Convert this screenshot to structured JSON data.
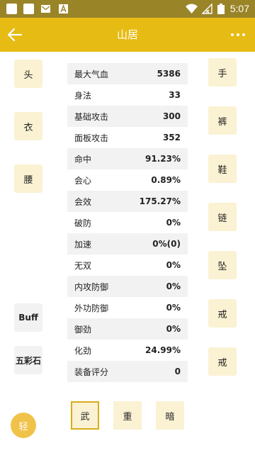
{
  "status_bar": {
    "time": "5:07",
    "left_icons": [
      "square-icon",
      "square-icon",
      "mail-icon",
      "a-icon"
    ],
    "right_icons": [
      "wifi-icon",
      "no-signal-icon",
      "battery-icon"
    ]
  },
  "app_bar": {
    "title": "山居",
    "back_icon": "arrow-back-icon",
    "menu_icon": "more-dots-icon",
    "color": "#e6bb14"
  },
  "equipment_left": [
    "头",
    "衣",
    "腰"
  ],
  "equipment_right": [
    "手",
    "裤",
    "鞋",
    "链",
    "坠",
    "戒",
    "戒"
  ],
  "side_buttons": [
    "Buff",
    "五彩石"
  ],
  "stats": [
    {
      "label": "最大气血",
      "value": "5386"
    },
    {
      "label": "身法",
      "value": "33"
    },
    {
      "label": "基础攻击",
      "value": "300"
    },
    {
      "label": "面板攻击",
      "value": "352"
    },
    {
      "label": "命中",
      "value": "91.23%"
    },
    {
      "label": "会心",
      "value": "0.89%"
    },
    {
      "label": "会效",
      "value": "175.27%"
    },
    {
      "label": "破防",
      "value": "0%"
    },
    {
      "label": "加速",
      "value": "0%(0)"
    },
    {
      "label": "无双",
      "value": "0%"
    },
    {
      "label": "内攻防御",
      "value": "0%"
    },
    {
      "label": "外功防御",
      "value": "0%"
    },
    {
      "label": "御劲",
      "value": "0%"
    },
    {
      "label": "化劲",
      "value": "24.99%"
    },
    {
      "label": "装备评分",
      "value": "0"
    }
  ],
  "weapon_tabs": [
    {
      "label": "武",
      "active": true
    },
    {
      "label": "重",
      "active": false
    },
    {
      "label": "暗",
      "active": false
    }
  ],
  "fab": {
    "label": "轻"
  }
}
